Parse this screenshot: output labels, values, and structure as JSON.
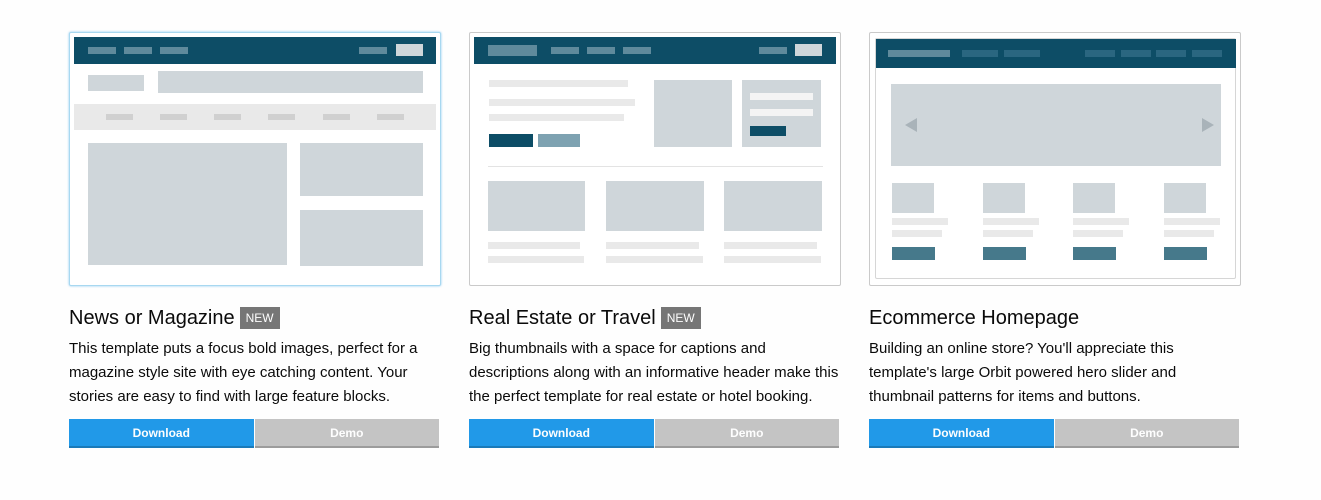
{
  "templates": [
    {
      "title": "News or Magazine",
      "badge": "NEW",
      "description": "This template puts a focus bold images, perfect for a magazine style site with eye catching content. Your stories are easy to find with large feature blocks.",
      "download_label": "Download",
      "demo_label": "Demo"
    },
    {
      "title": "Real Estate or Travel",
      "badge": "NEW",
      "description": "Big thumbnails with a space for captions and descriptions along with an informative header make this the perfect template for real estate or hotel booking.",
      "download_label": "Download",
      "demo_label": "Demo"
    },
    {
      "title": "Ecommerce Homepage",
      "description": "Building an online store? You'll appreciate this template's large Orbit powered hero slider and thumbnail patterns for items and buttons.",
      "download_label": "Download",
      "demo_label": "Demo"
    }
  ],
  "colors": {
    "primary": "#2199e8",
    "secondary": "#c4c4c4",
    "badge": "#767676",
    "wireframe_header": "#0d4d66",
    "wireframe_block": "#cfd6da"
  },
  "icons": [
    "slider-prev-arrow-icon",
    "slider-next-arrow-icon"
  ]
}
